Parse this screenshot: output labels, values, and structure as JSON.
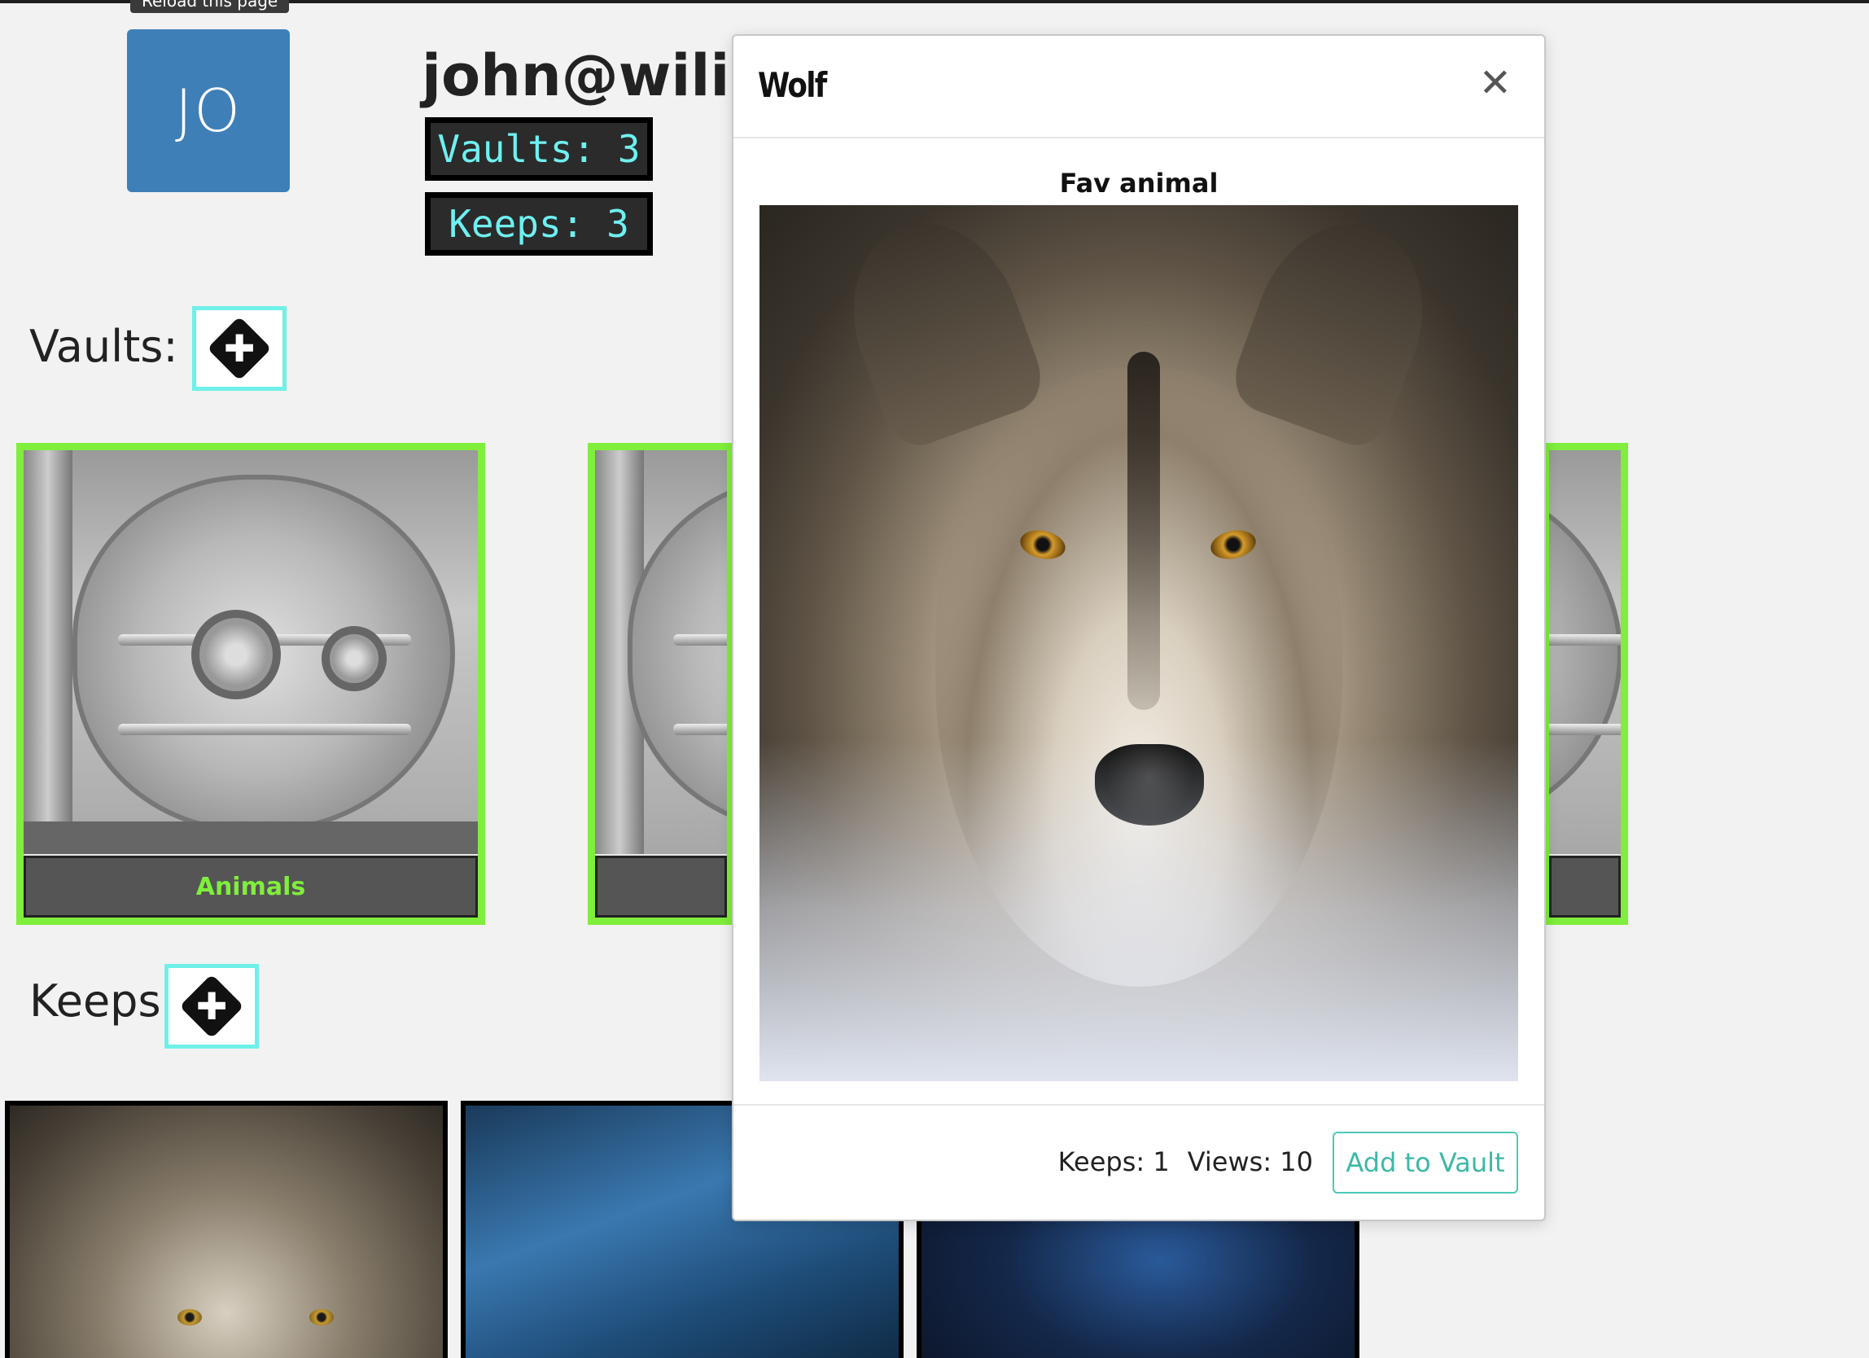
{
  "tooltip": "Reload this page",
  "profile": {
    "initials": "JO",
    "email": "john@wiliwo",
    "vaults_stat": "Vaults: 3",
    "keeps_stat": "Keeps: 3"
  },
  "vaults_section": {
    "label": "Vaults:",
    "add_icon": "plus-diamond-icon",
    "items": [
      {
        "title": "Animals"
      },
      {
        "title": ""
      },
      {
        "title": ""
      }
    ]
  },
  "keeps_section": {
    "label": "Keeps",
    "add_icon": "plus-diamond-icon"
  },
  "modal": {
    "title": "Wolf",
    "close_icon": "close-icon",
    "description": "Fav animal",
    "keeps": "Keeps: 1",
    "views": "Views: 10",
    "add_button": "Add to Vault"
  },
  "colors": {
    "accent_cyan": "#6ff0f0",
    "vault_border": "#7fee3c",
    "avatar_bg": "#3f7fb8",
    "button_teal": "#3db8a6"
  }
}
